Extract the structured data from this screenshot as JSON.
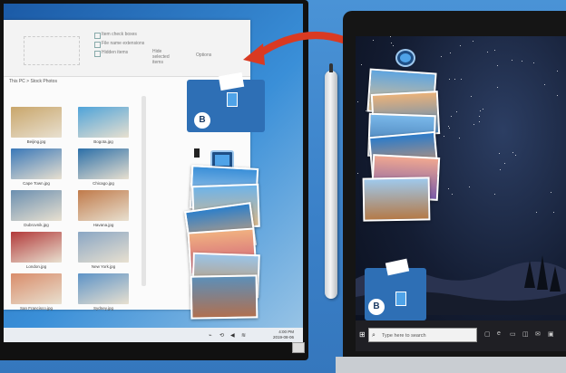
{
  "explorer": {
    "ribbon_items": [
      "Item check boxes",
      "File name extensions",
      "Hidden items",
      "Hide selected items",
      "Options"
    ],
    "address": "This PC > Stock Photos",
    "files": [
      {
        "label": "Beijing.jpg",
        "color": "#c9a66b"
      },
      {
        "label": "Bogota.jpg",
        "color": "#4fa3d9"
      },
      {
        "label": "Cape Town.jpg",
        "color": "#3a78b8"
      },
      {
        "label": "Chicago.jpg",
        "color": "#2b6fa8"
      },
      {
        "label": "Dubrovnik.jpg",
        "color": "#6b8fb0"
      },
      {
        "label": "Havana.jpg",
        "color": "#c07a4a"
      },
      {
        "label": "London.jpg",
        "color": "#b23a3a"
      },
      {
        "label": "New York.jpg",
        "color": "#8aa6c4"
      },
      {
        "label": "San Francisco.jpg",
        "color": "#d98c6a"
      },
      {
        "label": "Sydney.jpg",
        "color": "#5d93c7"
      }
    ]
  },
  "taskbar_left": {
    "time": "4:00 PM",
    "date": "2019-08-06"
  },
  "taskbar_right": {
    "search_placeholder": "Type here to search"
  },
  "widgets": {
    "b_label": "B"
  },
  "colors": {
    "arrow": "#d93a22",
    "folder": "#2e6fb5"
  },
  "icons": {
    "arrow": "double-headed-arrow",
    "windows": "windows-logo-icon",
    "search": "search-icon"
  }
}
